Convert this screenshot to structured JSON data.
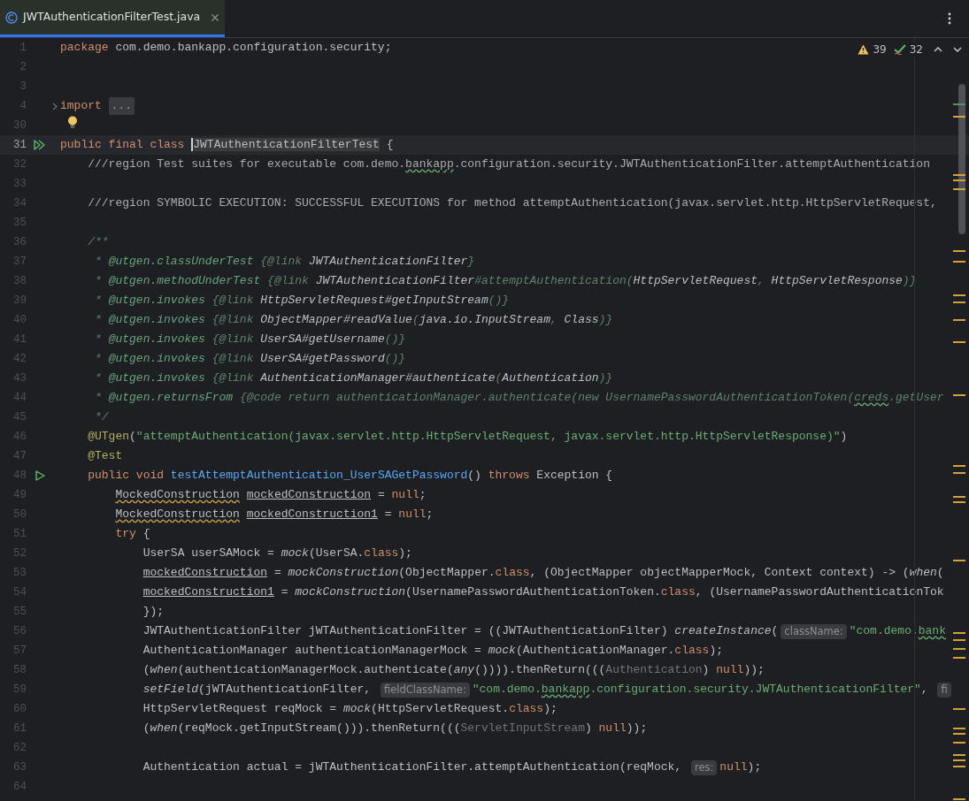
{
  "tab": {
    "label": "JWTAuthenticationFilterTest.java",
    "selected": true
  },
  "inspections": {
    "warnings": "39",
    "checks": "32"
  },
  "lines": [
    {
      "number": "1",
      "current": false,
      "tokens": [
        {
          "kind": "kw",
          "text": "package "
        },
        {
          "kind": "plain",
          "text": "com.demo.bankapp.configuration.security;"
        }
      ]
    },
    {
      "number": "2",
      "current": false
    },
    {
      "number": "3",
      "current": false
    },
    {
      "number": "4",
      "current": false,
      "kind": "fold",
      "tokens": [
        {
          "kind": "kw",
          "text": "import "
        },
        {
          "kind": "folded",
          "text": "..."
        }
      ]
    },
    {
      "number": "30",
      "current": false,
      "kind": "bulb"
    },
    {
      "number": "31",
      "current": true,
      "kind": "run_all",
      "tokens": [
        {
          "kind": "kw",
          "text": "public final class "
        },
        {
          "kind": "caret",
          "text": "JWTAuthenticationFilterTest"
        },
        {
          "kind": "plain",
          "text": " {"
        }
      ]
    },
    {
      "number": "32",
      "current": false,
      "tokens": [
        {
          "kind": "comment",
          "text": "    ///region Test suites for executable com.demo."
        },
        {
          "kind": "comment_typo",
          "text": "bankapp"
        },
        {
          "kind": "comment",
          "text": ".configuration.security.JWTAuthenticationFilter.attemptAuthentication"
        }
      ]
    },
    {
      "number": "33",
      "current": false
    },
    {
      "number": "34",
      "current": false,
      "tokens": [
        {
          "kind": "comment",
          "text": "    ///region SYMBOLIC EXECUTION: SUCCESSFUL EXECUTIONS for method attemptAuthentication(javax.servlet.http.HttpServletRequest,"
        }
      ]
    },
    {
      "number": "35",
      "current": false
    },
    {
      "number": "36",
      "current": false,
      "tokens": [
        {
          "kind": "doc",
          "text": "    /**"
        }
      ]
    },
    {
      "number": "37",
      "current": false,
      "tokens": [
        {
          "kind": "doc",
          "text": "     * "
        },
        {
          "kind": "doc_tag",
          "text": "@utgen.classUnderTest"
        },
        {
          "kind": "doc",
          "text": " {@link "
        },
        {
          "kind": "doc_ref",
          "text": "JWTAuthenticationFilter"
        },
        {
          "kind": "doc",
          "text": "}"
        }
      ]
    },
    {
      "number": "38",
      "current": false,
      "tokens": [
        {
          "kind": "doc",
          "text": "     * "
        },
        {
          "kind": "doc_tag",
          "text": "@utgen.methodUnderTest"
        },
        {
          "kind": "doc",
          "text": " {@link "
        },
        {
          "kind": "doc_ref",
          "text": "JWTAuthenticationFilter"
        },
        {
          "kind": "doc",
          "text": "#attemptAuthentication("
        },
        {
          "kind": "doc_ref",
          "text": "HttpServletRequest"
        },
        {
          "kind": "doc",
          "text": ", "
        },
        {
          "kind": "doc_ref",
          "text": "HttpServletResponse"
        },
        {
          "kind": "doc",
          "text": ")}"
        }
      ]
    },
    {
      "number": "39",
      "current": false,
      "tokens": [
        {
          "kind": "doc",
          "text": "     * "
        },
        {
          "kind": "doc_tag",
          "text": "@utgen.invokes"
        },
        {
          "kind": "doc",
          "text": " {@link "
        },
        {
          "kind": "doc_ref",
          "text": "HttpServletRequest#getInputStream"
        },
        {
          "kind": "doc",
          "text": "()}"
        }
      ]
    },
    {
      "number": "40",
      "current": false,
      "tokens": [
        {
          "kind": "doc",
          "text": "     * "
        },
        {
          "kind": "doc_tag",
          "text": "@utgen.invokes"
        },
        {
          "kind": "doc",
          "text": " {@link "
        },
        {
          "kind": "doc_ref",
          "text": "ObjectMapper#readValue"
        },
        {
          "kind": "doc",
          "text": "("
        },
        {
          "kind": "doc_ref",
          "text": "java.io.InputStream"
        },
        {
          "kind": "doc",
          "text": ", "
        },
        {
          "kind": "doc_ref",
          "text": "Class"
        },
        {
          "kind": "doc",
          "text": ")}"
        }
      ]
    },
    {
      "number": "41",
      "current": false,
      "tokens": [
        {
          "kind": "doc",
          "text": "     * "
        },
        {
          "kind": "doc_tag",
          "text": "@utgen.invokes"
        },
        {
          "kind": "doc",
          "text": " {@link "
        },
        {
          "kind": "doc_ref",
          "text": "UserSA#getUsername"
        },
        {
          "kind": "doc",
          "text": "()}"
        }
      ]
    },
    {
      "number": "42",
      "current": false,
      "tokens": [
        {
          "kind": "doc",
          "text": "     * "
        },
        {
          "kind": "doc_tag",
          "text": "@utgen.invokes"
        },
        {
          "kind": "doc",
          "text": " {@link "
        },
        {
          "kind": "doc_ref",
          "text": "UserSA#getPassword"
        },
        {
          "kind": "doc",
          "text": "()}"
        }
      ]
    },
    {
      "number": "43",
      "current": false,
      "tokens": [
        {
          "kind": "doc",
          "text": "     * "
        },
        {
          "kind": "doc_tag",
          "text": "@utgen.invokes"
        },
        {
          "kind": "doc",
          "text": " {@link "
        },
        {
          "kind": "doc_ref",
          "text": "AuthenticationManager#authenticate"
        },
        {
          "kind": "doc",
          "text": "("
        },
        {
          "kind": "doc_ref",
          "text": "Authentication"
        },
        {
          "kind": "doc",
          "text": ")}"
        }
      ]
    },
    {
      "number": "44",
      "current": false,
      "tokens": [
        {
          "kind": "doc",
          "text": "     * "
        },
        {
          "kind": "doc_tag",
          "text": "@utgen.returnsFrom"
        },
        {
          "kind": "doc",
          "text": " {@code return authenticationManager.authenticate(new UsernamePasswordAuthenticationToken("
        },
        {
          "kind": "doc_typo",
          "text": "creds"
        },
        {
          "kind": "doc",
          "text": ".getUser"
        }
      ]
    },
    {
      "number": "45",
      "current": false,
      "tokens": [
        {
          "kind": "doc",
          "text": "     */"
        }
      ]
    },
    {
      "number": "46",
      "current": false,
      "tokens": [
        {
          "kind": "annotation",
          "text": "    @UTgen"
        },
        {
          "kind": "plain",
          "text": "("
        },
        {
          "kind": "string",
          "text": "\"attemptAuthentication(javax.servlet.http.HttpServletRequest, javax.servlet.http.HttpServletResponse)\""
        },
        {
          "kind": "plain",
          "text": ")"
        }
      ]
    },
    {
      "number": "47",
      "current": false,
      "tokens": [
        {
          "kind": "annotation",
          "text": "    @Test"
        }
      ]
    },
    {
      "number": "48",
      "current": false,
      "kind": "run",
      "tokens": [
        {
          "kind": "kw",
          "text": "    public void "
        },
        {
          "kind": "decl",
          "text": "testAttemptAuthentication_UserSAGetPassword"
        },
        {
          "kind": "plain",
          "text": "() "
        },
        {
          "kind": "kw",
          "text": "throws "
        },
        {
          "kind": "plain",
          "text": "Exception {"
        }
      ]
    },
    {
      "number": "49",
      "current": false,
      "tokens": [
        {
          "kind": "wavy",
          "text": "        MockedConstruction"
        },
        {
          "kind": "underlined",
          "text": " mockedConstruction"
        },
        {
          "kind": "plain",
          "text": " = "
        },
        {
          "kind": "kw",
          "text": "null"
        },
        {
          "kind": "plain",
          "text": ";"
        }
      ]
    },
    {
      "number": "50",
      "current": false,
      "tokens": [
        {
          "kind": "wavy",
          "text": "        MockedConstruction"
        },
        {
          "kind": "underlined",
          "text": " mockedConstruction1"
        },
        {
          "kind": "plain",
          "text": " = "
        },
        {
          "kind": "kw",
          "text": "null"
        },
        {
          "kind": "plain",
          "text": ";"
        }
      ]
    },
    {
      "number": "51",
      "current": false,
      "tokens": [
        {
          "kind": "kw",
          "text": "        try "
        },
        {
          "kind": "plain",
          "text": "{"
        }
      ]
    },
    {
      "number": "52",
      "current": false,
      "tokens": [
        {
          "kind": "plain",
          "text": "            UserSA userSAMock = "
        },
        {
          "kind": "static",
          "text": "mock"
        },
        {
          "kind": "plain",
          "text": "(UserSA."
        },
        {
          "kind": "kw",
          "text": "class"
        },
        {
          "kind": "plain",
          "text": ");"
        }
      ]
    },
    {
      "number": "53",
      "current": false,
      "tokens": [
        {
          "kind": "underlined",
          "text": "            mockedConstruction"
        },
        {
          "kind": "plain",
          "text": " = "
        },
        {
          "kind": "static",
          "text": "mockConstruction"
        },
        {
          "kind": "plain",
          "text": "(ObjectMapper."
        },
        {
          "kind": "kw",
          "text": "class"
        },
        {
          "kind": "plain",
          "text": ", (ObjectMapper objectMapperMock, Context context) -> ("
        },
        {
          "kind": "static",
          "text": "when"
        },
        {
          "kind": "plain",
          "text": "("
        }
      ]
    },
    {
      "number": "54",
      "current": false,
      "tokens": [
        {
          "kind": "underlined",
          "text": "            mockedConstruction1"
        },
        {
          "kind": "plain",
          "text": " = "
        },
        {
          "kind": "static",
          "text": "mockConstruction"
        },
        {
          "kind": "plain",
          "text": "(UsernamePasswordAuthenticationToken."
        },
        {
          "kind": "kw",
          "text": "class"
        },
        {
          "kind": "plain",
          "text": ", (UsernamePasswordAuthenticationTok"
        }
      ]
    },
    {
      "number": "55",
      "current": false,
      "tokens": [
        {
          "kind": "plain",
          "text": "            });"
        }
      ]
    },
    {
      "number": "56",
      "current": false,
      "tokens": [
        {
          "kind": "plain",
          "text": "            JWTAuthenticationFilter jWTAuthenticationFilter = ((JWTAuthenticationFilter) "
        },
        {
          "kind": "static",
          "text": "createInstance"
        },
        {
          "kind": "plain",
          "text": "("
        },
        {
          "kind": "hint",
          "text": "className:"
        },
        {
          "kind": "string",
          "text": "\"com.demo."
        },
        {
          "kind": "string_typo",
          "text": "bank"
        }
      ]
    },
    {
      "number": "57",
      "current": false,
      "tokens": [
        {
          "kind": "plain",
          "text": "            AuthenticationManager authenticationManagerMock = "
        },
        {
          "kind": "static",
          "text": "mock"
        },
        {
          "kind": "plain",
          "text": "(AuthenticationManager."
        },
        {
          "kind": "kw",
          "text": "class"
        },
        {
          "kind": "plain",
          "text": ");"
        }
      ]
    },
    {
      "number": "58",
      "current": false,
      "tokens": [
        {
          "kind": "plain",
          "text": "            ("
        },
        {
          "kind": "static",
          "text": "when"
        },
        {
          "kind": "plain",
          "text": "(authenticationManagerMock.authenticate("
        },
        {
          "kind": "static",
          "text": "any"
        },
        {
          "kind": "plain",
          "text": "()))).thenReturn((("
        },
        {
          "kind": "dim",
          "text": "Authentication"
        },
        {
          "kind": "plain",
          "text": ") "
        },
        {
          "kind": "kw",
          "text": "null"
        },
        {
          "kind": "plain",
          "text": "));"
        }
      ]
    },
    {
      "number": "59",
      "current": false,
      "tokens": [
        {
          "kind": "static",
          "text": "            setField"
        },
        {
          "kind": "plain",
          "text": "(jWTAuthenticationFilter, "
        },
        {
          "kind": "hint",
          "text": "fieldClassName:"
        },
        {
          "kind": "string",
          "text": "\"com.demo."
        },
        {
          "kind": "string_typo",
          "text": "bankapp"
        },
        {
          "kind": "string",
          "text": ".configuration.security.JWTAuthenticationFilter\""
        },
        {
          "kind": "plain",
          "text": ", "
        },
        {
          "kind": "hint",
          "text": "fi"
        }
      ]
    },
    {
      "number": "60",
      "current": false,
      "tokens": [
        {
          "kind": "plain",
          "text": "            HttpServletRequest reqMock = "
        },
        {
          "kind": "static",
          "text": "mock"
        },
        {
          "kind": "plain",
          "text": "(HttpServletRequest."
        },
        {
          "kind": "kw",
          "text": "class"
        },
        {
          "kind": "plain",
          "text": ");"
        }
      ]
    },
    {
      "number": "61",
      "current": false,
      "tokens": [
        {
          "kind": "plain",
          "text": "            ("
        },
        {
          "kind": "static",
          "text": "when"
        },
        {
          "kind": "plain",
          "text": "(reqMock.getInputStream())).thenReturn((("
        },
        {
          "kind": "dim",
          "text": "ServletInputStream"
        },
        {
          "kind": "plain",
          "text": ") "
        },
        {
          "kind": "kw",
          "text": "null"
        },
        {
          "kind": "plain",
          "text": "));"
        }
      ]
    },
    {
      "number": "62",
      "current": false
    },
    {
      "number": "63",
      "current": false,
      "tokens": [
        {
          "kind": "plain",
          "text": "            Authentication actual = jWTAuthenticationFilter.attemptAuthentication(reqMock, "
        },
        {
          "kind": "hint",
          "text": "res:"
        },
        {
          "kind": "kw",
          "text": "null"
        },
        {
          "kind": "plain",
          "text": ");"
        }
      ]
    },
    {
      "number": "64",
      "current": false
    }
  ]
}
